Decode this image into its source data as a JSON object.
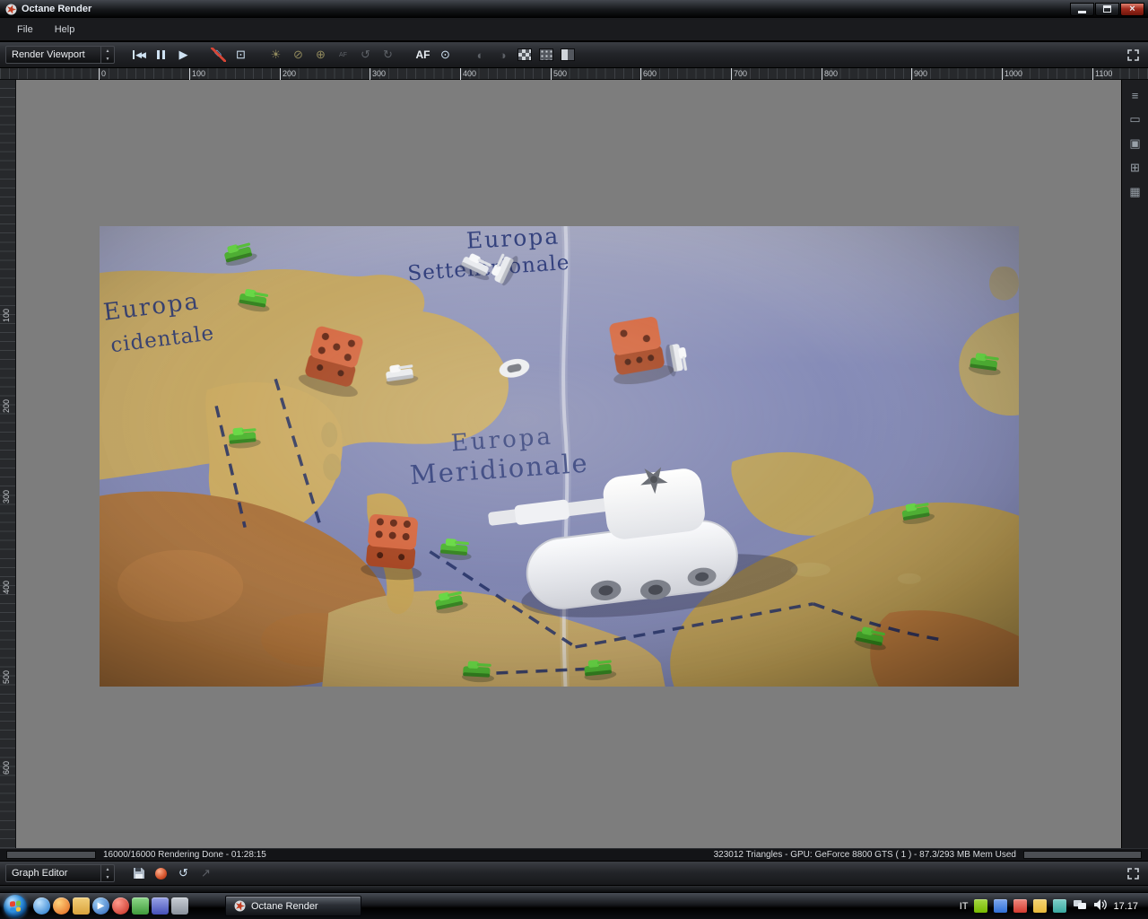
{
  "window": {
    "title": "Octane Render",
    "close_glyph": "×"
  },
  "menu": {
    "file": "File",
    "help": "Help"
  },
  "toolbar": {
    "viewport_selector": "Render Viewport",
    "af_label": "AF"
  },
  "graph_editor": {
    "selector": "Graph Editor"
  },
  "icons": {
    "spin_up": "▲",
    "spin_down": "▼",
    "rewind": "◀◀",
    "play": "▶",
    "pencil": "✎",
    "fit": "⊡",
    "lamp": "☀",
    "lock": "⊘",
    "picker": "⊕",
    "af_small": "AF",
    "rotate_ccw": "↺",
    "rotate_cw": "↻",
    "focus": "⊙",
    "half_left": "◐",
    "half_right": "◑",
    "menu_lines": "≡",
    "monitor": "▭",
    "save": "▣",
    "grid": "⊞",
    "image": "▦",
    "export": "↗"
  },
  "ruler_h": [
    "0",
    "100",
    "200",
    "300",
    "400",
    "500",
    "600",
    "700",
    "800",
    "900",
    "1000",
    "1100"
  ],
  "ruler_v": [
    "100",
    "200",
    "300",
    "400",
    "500",
    "600"
  ],
  "viewport_labels": {
    "north1": "Europa",
    "north2": "Settentrionale",
    "west1": "Europa",
    "west2": "cidentale",
    "south1": "Europa",
    "south2": "Meridionale"
  },
  "status": {
    "left": "16000/16000 Rendering Done - 01:28:15",
    "right": "323012 Triangles - GPU: GeForce 8800 GTS ( 1 ) - 87.3/293 MB Mem Used",
    "progress_left_pct": 100,
    "progress_mem_pct": 30
  },
  "taskbar": {
    "task_button": "Octane Render",
    "language": "IT",
    "clock": "17.17"
  },
  "colors": {
    "viewport_bg": "#7d7d7d",
    "sea": "#8289b8",
    "land_tan": "#c3a55f",
    "land_brown": "#a9763f",
    "map_text": "#1d2d70",
    "die": "#cf5b36",
    "tank_green": "#57c838",
    "close_button": "#a12b1d"
  }
}
